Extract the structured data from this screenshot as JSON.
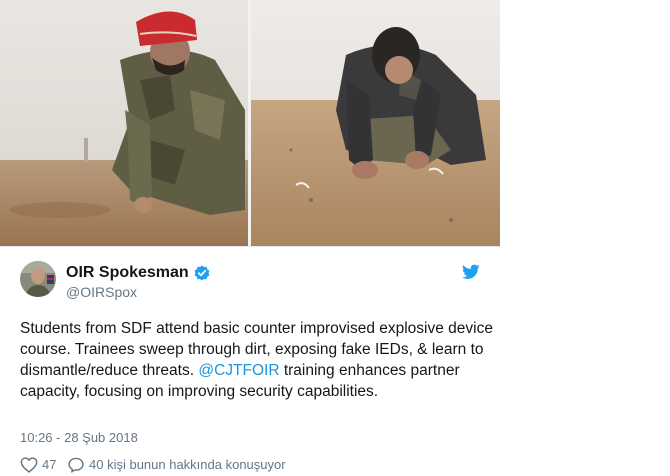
{
  "tweet": {
    "author_name": "OIR Spokesman",
    "handle": "@OIRSpox",
    "text_before": "Students from SDF attend basic counter improvised explosive device course. Trainees sweep through dirt, exposing fake IEDs, & learn to dismantle/reduce threats. ",
    "mention": "@CJTFOIR",
    "text_after": " training enhances partner capacity, focusing on improving security capabilities.",
    "timestamp": "10:26 - 28 Şub 2018",
    "like_count": "47",
    "conversation_text": "40 kişi bunun hakkında konuşuyor"
  },
  "icons": {
    "info": "info-icon",
    "verified": "verified-badge-icon",
    "twitter": "twitter-bird-icon",
    "heart": "heart-icon",
    "reply": "reply-bubble-icon"
  },
  "colors": {
    "link": "#1b95e0",
    "verified": "#1da1f2",
    "meta_text": "#657786",
    "body_text": "#14171a"
  },
  "info_glyph": "i"
}
